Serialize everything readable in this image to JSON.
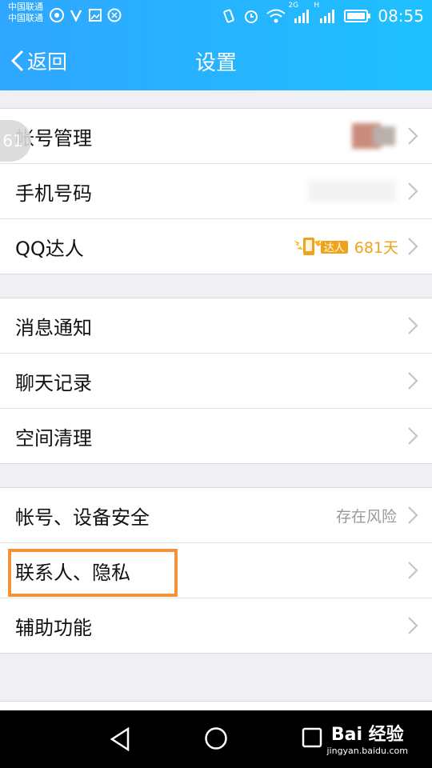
{
  "status_bar": {
    "carrier_1": "中国联通",
    "carrier_2": "中国联通",
    "network_2g": "2G",
    "network_h": "H",
    "time": "08:55"
  },
  "nav": {
    "back_label": "返回",
    "title": "设置"
  },
  "edge_bubble_text": "61",
  "groups": [
    {
      "items": [
        {
          "label": "帐号管理",
          "value": ""
        },
        {
          "label": "手机号码",
          "value": ""
        },
        {
          "label": "QQ达人",
          "badge": "达人",
          "days": "681天"
        }
      ]
    },
    {
      "items": [
        {
          "label": "消息通知"
        },
        {
          "label": "聊天记录"
        },
        {
          "label": "空间清理"
        }
      ]
    },
    {
      "items": [
        {
          "label": "帐号、设备安全",
          "value": "存在风险"
        },
        {
          "label": "联系人、隐私"
        },
        {
          "label": "辅助功能"
        }
      ]
    }
  ],
  "watermark": {
    "brand": "Bai 经验",
    "url": "jingyan.baidu.com"
  },
  "colors": {
    "header_start": "#2fa6ff",
    "header_end": "#1ec0ff",
    "highlight": "#f4923a",
    "badge": "#f0a21a"
  }
}
